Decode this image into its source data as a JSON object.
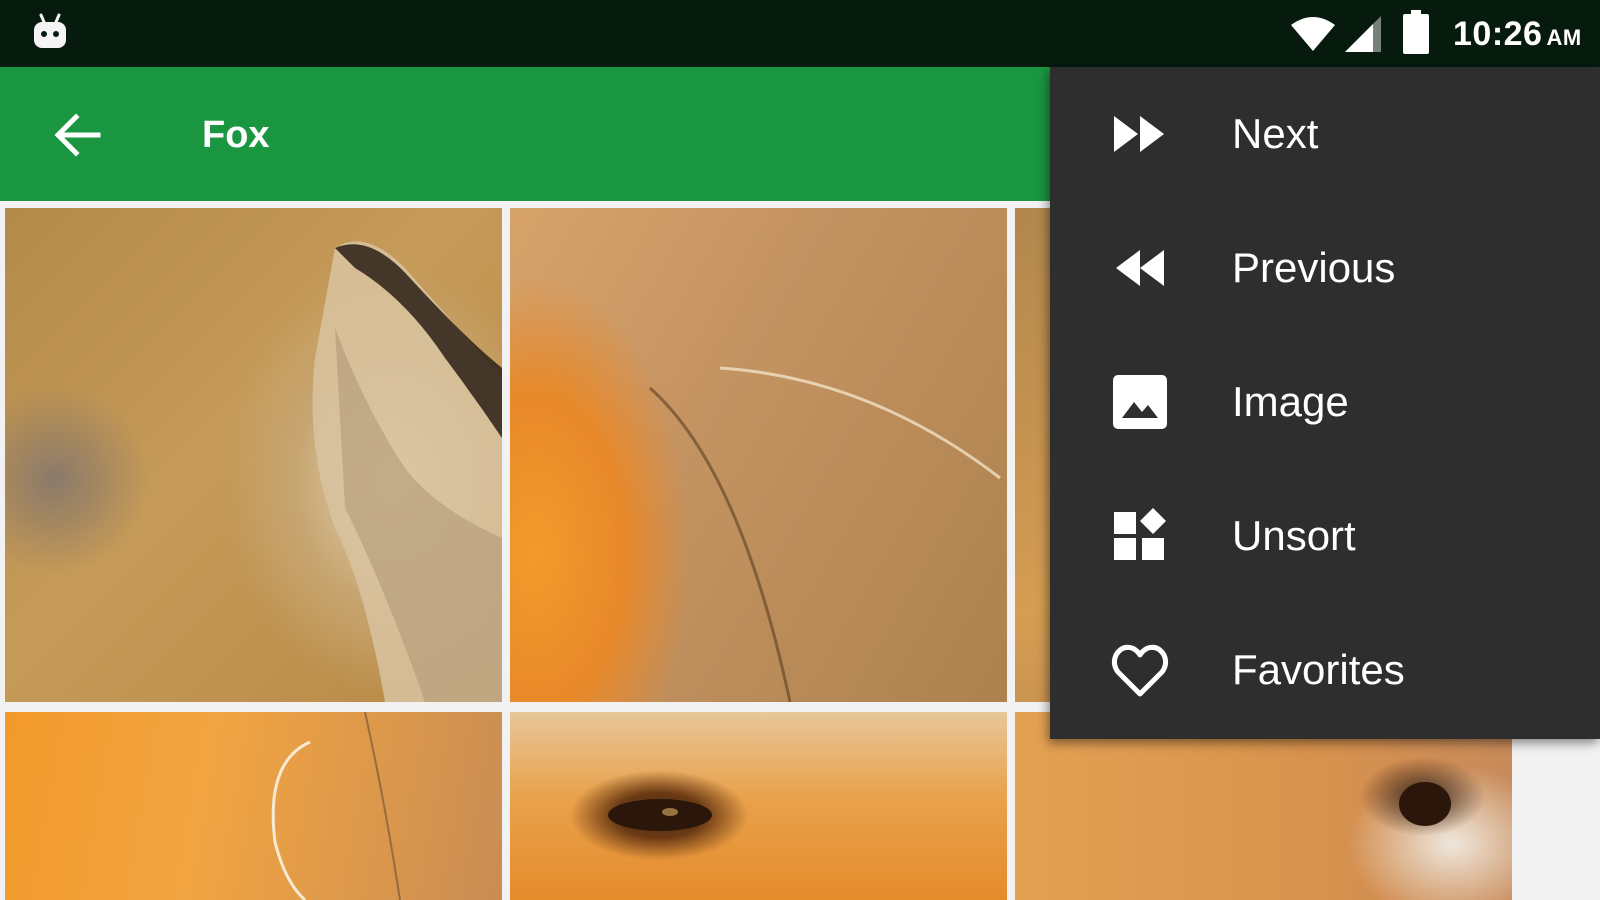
{
  "status_bar": {
    "time": "10:26",
    "ampm": "AM",
    "icons": [
      "android-debug-icon",
      "wifi-icon",
      "cell-signal-icon",
      "battery-icon"
    ]
  },
  "app_bar": {
    "title": "Fox",
    "back_icon": "arrow-back-icon",
    "color": "#1a9641"
  },
  "puzzle": {
    "subject": "fox",
    "tiles_visible": 6
  },
  "menu": {
    "background": "#2e2e2e",
    "items": [
      {
        "label": "Next",
        "icon": "fast-forward-icon"
      },
      {
        "label": "Previous",
        "icon": "rewind-icon"
      },
      {
        "label": "Image",
        "icon": "image-icon"
      },
      {
        "label": "Unsort",
        "icon": "unsort-icon"
      },
      {
        "label": "Favorites",
        "icon": "heart-icon"
      }
    ]
  }
}
